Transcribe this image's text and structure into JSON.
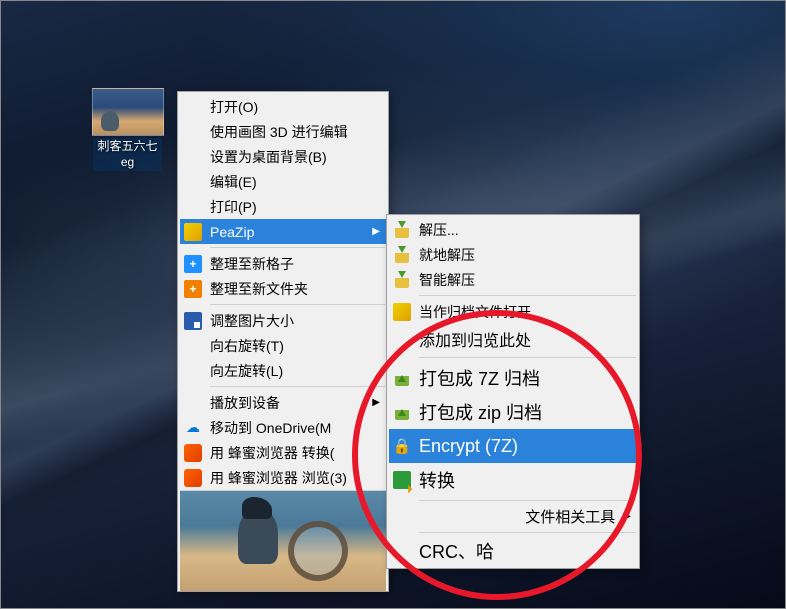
{
  "desktop": {
    "file_label_line1": "刺客五六七",
    "file_label_line2": "eg"
  },
  "menu1": {
    "open": "打开(O)",
    "edit3d": "使用画图 3D 进行编辑",
    "set_wallpaper": "设置为桌面背景(B)",
    "edit": "编辑(E)",
    "print": "打印(P)",
    "peazip": "PeaZip",
    "tidy_grid": "整理至新格子",
    "tidy_folder": "整理至新文件夹",
    "resize": "调整图片大小",
    "rotate_right": "向右旋转(T)",
    "rotate_left": "向左旋转(L)",
    "cast": "播放到设备",
    "onedrive": "移动到 OneDrive(M",
    "convert_browser": "用 蜂蜜浏览器 转换(",
    "browse_browser": "用 蜂蜜浏览器 浏览(3)"
  },
  "menu2": {
    "extract": "解压...",
    "extract_here": "就地解压",
    "smart_extract": "智能解压",
    "open_archive": "当作归档文件打开",
    "add_browse": "添加到归览此处",
    "pack_7z": "打包成 7Z 归档",
    "pack_zip": "打包成 zip 归档",
    "encrypt": "Encrypt (7Z)",
    "convert": "转换",
    "tools": "文件相关工具",
    "crc": "CRC、哈"
  }
}
